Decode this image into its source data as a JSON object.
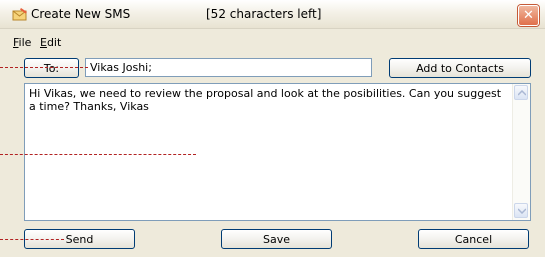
{
  "window": {
    "title": "Create New SMS",
    "status": "[52 characters left]",
    "close_glyph": "✕"
  },
  "menu": [
    {
      "label_first": "F",
      "label_rest": "ile"
    },
    {
      "label_first": "E",
      "label_rest": "dit"
    }
  ],
  "recipient": {
    "to_label": "To:",
    "value": "Vikas Joshi;",
    "add_contacts_label": "Add to Contacts"
  },
  "message": {
    "text": "Hi Vikas, we need to review the proposal and look at the posibilities. Can you suggest a time? Thanks, Vikas"
  },
  "actions": {
    "send_label": "Send",
    "save_label": "Save",
    "cancel_label": "Cancel"
  },
  "colors": {
    "window_bg": "#eeeadb",
    "button_border": "#003c74",
    "input_border": "#7f9db9",
    "callout_line": "#b22222",
    "close_button": "#e0704b"
  },
  "icons": [
    "envelope-pencil-icon",
    "close-icon",
    "scroll-up-icon",
    "scroll-down-icon"
  ]
}
